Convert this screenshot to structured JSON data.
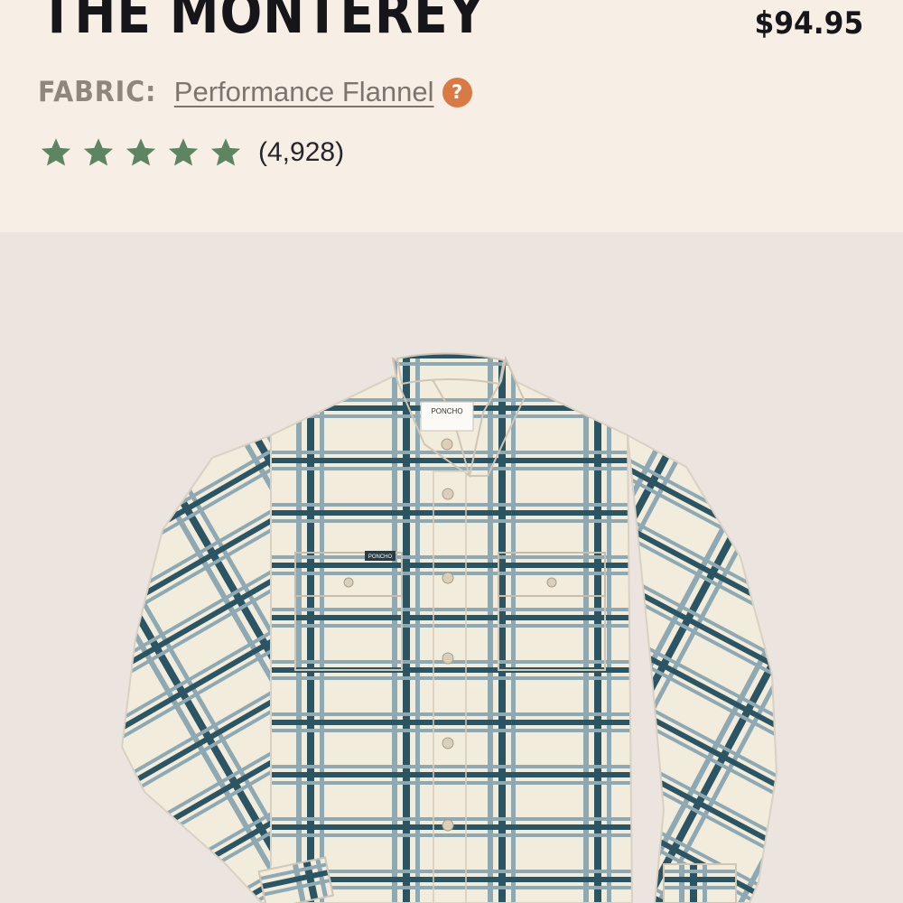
{
  "product": {
    "title": "THE MONTEREY",
    "price": "$94.95",
    "fabric_label": "FABRIC:",
    "fabric_value": "Performance Flannel",
    "help_icon": "?",
    "rating": {
      "stars": 5,
      "max": 5,
      "count": "(4,928)",
      "star_color": "#5e8561"
    }
  },
  "image": {
    "alt": "Cream plaid flannel shirt with blue-grey check",
    "label_text": "PONCHO",
    "pocket_tag_text": "PONCHO",
    "shirt_base": "#f2ecdd",
    "check_dark": "#2b5563",
    "check_light": "#8fa9b3"
  },
  "colors": {
    "header_bg": "#f7efe6",
    "gallery_bg": "#ebe4df",
    "accent": "#d97a45"
  }
}
